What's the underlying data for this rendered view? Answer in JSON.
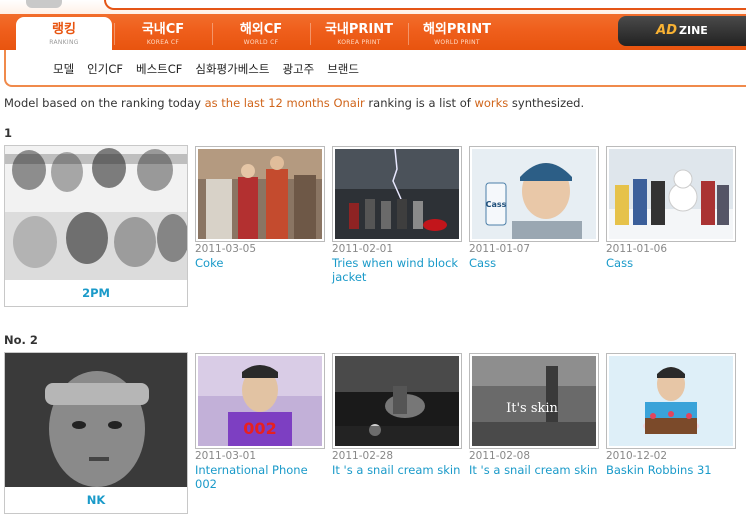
{
  "header": {
    "tabs": [
      {
        "ko": "랭킹",
        "en": "RANKING",
        "active": true
      },
      {
        "ko": "국내CF",
        "en": "KOREA CF",
        "active": false
      },
      {
        "ko": "해외CF",
        "en": "WORLD CF",
        "active": false
      },
      {
        "ko": "국내PRINT",
        "en": "KOREA PRINT",
        "active": false
      },
      {
        "ko": "해외PRINT",
        "en": "WORLD PRINT",
        "active": false
      }
    ],
    "adzine": {
      "ad": "AD",
      "zine": "ZINE"
    }
  },
  "subnav": [
    "모델",
    "인기CF",
    "베스트CF",
    "심화평가베스트",
    "광고주",
    "브랜드"
  ],
  "intro": {
    "part1": "Model based on the ranking today ",
    "hl1": "as the last 12 months Onair",
    "part2": " ranking is a list of ",
    "hl2": "works",
    "part3": " synthesized."
  },
  "rankings": [
    {
      "label": "1",
      "model": "2PM",
      "works": [
        {
          "date": "2011-03-05",
          "title": "Coke"
        },
        {
          "date": "2011-02-01",
          "title": "Tries when wind block jacket"
        },
        {
          "date": "2011-01-07",
          "title": "Cass"
        },
        {
          "date": "2011-01-06",
          "title": "Cass"
        }
      ]
    },
    {
      "label": "No. 2",
      "model": "NK",
      "works": [
        {
          "date": "2011-03-01",
          "title": "International Phone 002"
        },
        {
          "date": "2011-02-28",
          "title": "It 's a snail cream skin"
        },
        {
          "date": "2011-02-08",
          "title": "It 's a snail cream skin"
        },
        {
          "date": "2010-12-02",
          "title": "Baskin Robbins 31"
        }
      ]
    }
  ],
  "thumb_text": {
    "cass1": "Cass",
    "skin": "It's skin"
  },
  "colors": {
    "accent": "#e8540f",
    "link": "#1a9ac9",
    "highlight": "#d0651b"
  }
}
